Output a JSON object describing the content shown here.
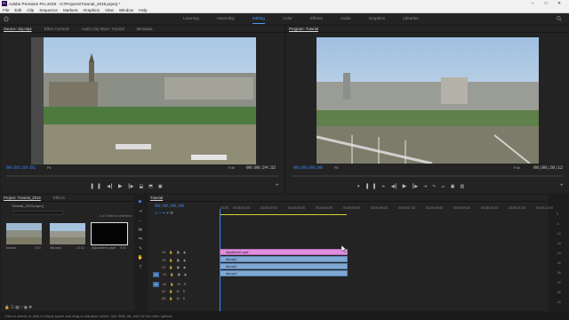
{
  "titlebar": {
    "title": "Adobe Premiere Pro 2019 - G:\\Projects\\Tutorial_2019.prproj *",
    "icon": "Pr"
  },
  "menu": [
    "File",
    "Edit",
    "Clip",
    "Sequence",
    "Markers",
    "Graphics",
    "View",
    "Window",
    "Help"
  ],
  "workspaces": {
    "tabs": [
      "Learning",
      "Assembly",
      "Editing",
      "Color",
      "Effects",
      "Audio",
      "Graphics",
      "Libraries"
    ],
    "active": "Editing"
  },
  "source_panel": {
    "tabs": [
      "Source: city.mp4",
      "Effect Controls",
      "Audio Clip Mixer: Tutorial",
      "Metadata"
    ],
    "timecode_current": "00:03:33:01",
    "fit": "Fit",
    "resolution": "Full",
    "timecode_duration": "00:00:24:32"
  },
  "program_panel": {
    "tabs": [
      "Program: Tutorial"
    ],
    "timecode_current": "00;00;00;00",
    "fit": "Fit",
    "resolution": "Full",
    "timecode_duration": "00;00;20;12"
  },
  "project_panel": {
    "tabs": [
      "Project: Tutorial_2019",
      "Effects"
    ],
    "project_name": "Tutorial_2019.prproj",
    "items_selected": "1 of 3 items selected",
    "items": [
      {
        "name": "tutorial",
        "meta": "5:00"
      },
      {
        "name": "city.mp4",
        "meta": "24:32"
      },
      {
        "name": "Adjustment Layer",
        "meta": "5:00"
      }
    ]
  },
  "timeline": {
    "tabs": [
      "Tutorial"
    ],
    "timecode": "00;00;00;00",
    "ruler": [
      "00;00",
      "00;00;01;00",
      "00;00;02;00",
      "00;00;03;00",
      "00;00;04;00",
      "00;00;05;00",
      "00;00;06;00",
      "00;00;07;00",
      "00;00;08;00",
      "00;00;09;00",
      "00;00;10;00",
      "00;00;11;00",
      "00;00;12;00"
    ],
    "video_tracks": [
      "V4",
      "V3",
      "V2",
      "V1"
    ],
    "audio_tracks": [
      "A1",
      "A2",
      "A3"
    ],
    "clips": [
      {
        "track": "V4",
        "label": "Adjustment Layer",
        "kind": "adj"
      },
      {
        "track": "V3",
        "label": "city.mp4",
        "kind": "vid"
      },
      {
        "track": "V2",
        "label": "city.mp4",
        "kind": "vid"
      },
      {
        "track": "V1",
        "label": "city.mp4",
        "kind": "vid"
      }
    ],
    "meter_labels": [
      "0",
      "-6",
      "-12",
      "-18",
      "-24",
      "-30",
      "-36",
      "-42",
      "-48",
      "-54"
    ]
  },
  "status": "Click to select, or click in empty space and drag to marquee select. Use Shift, Alt, and Ctrl for other options.",
  "colors": {
    "accent": "#3c8bff",
    "adjustment_clip": "#e08fe0",
    "video_clip": "#7fa8d3"
  }
}
